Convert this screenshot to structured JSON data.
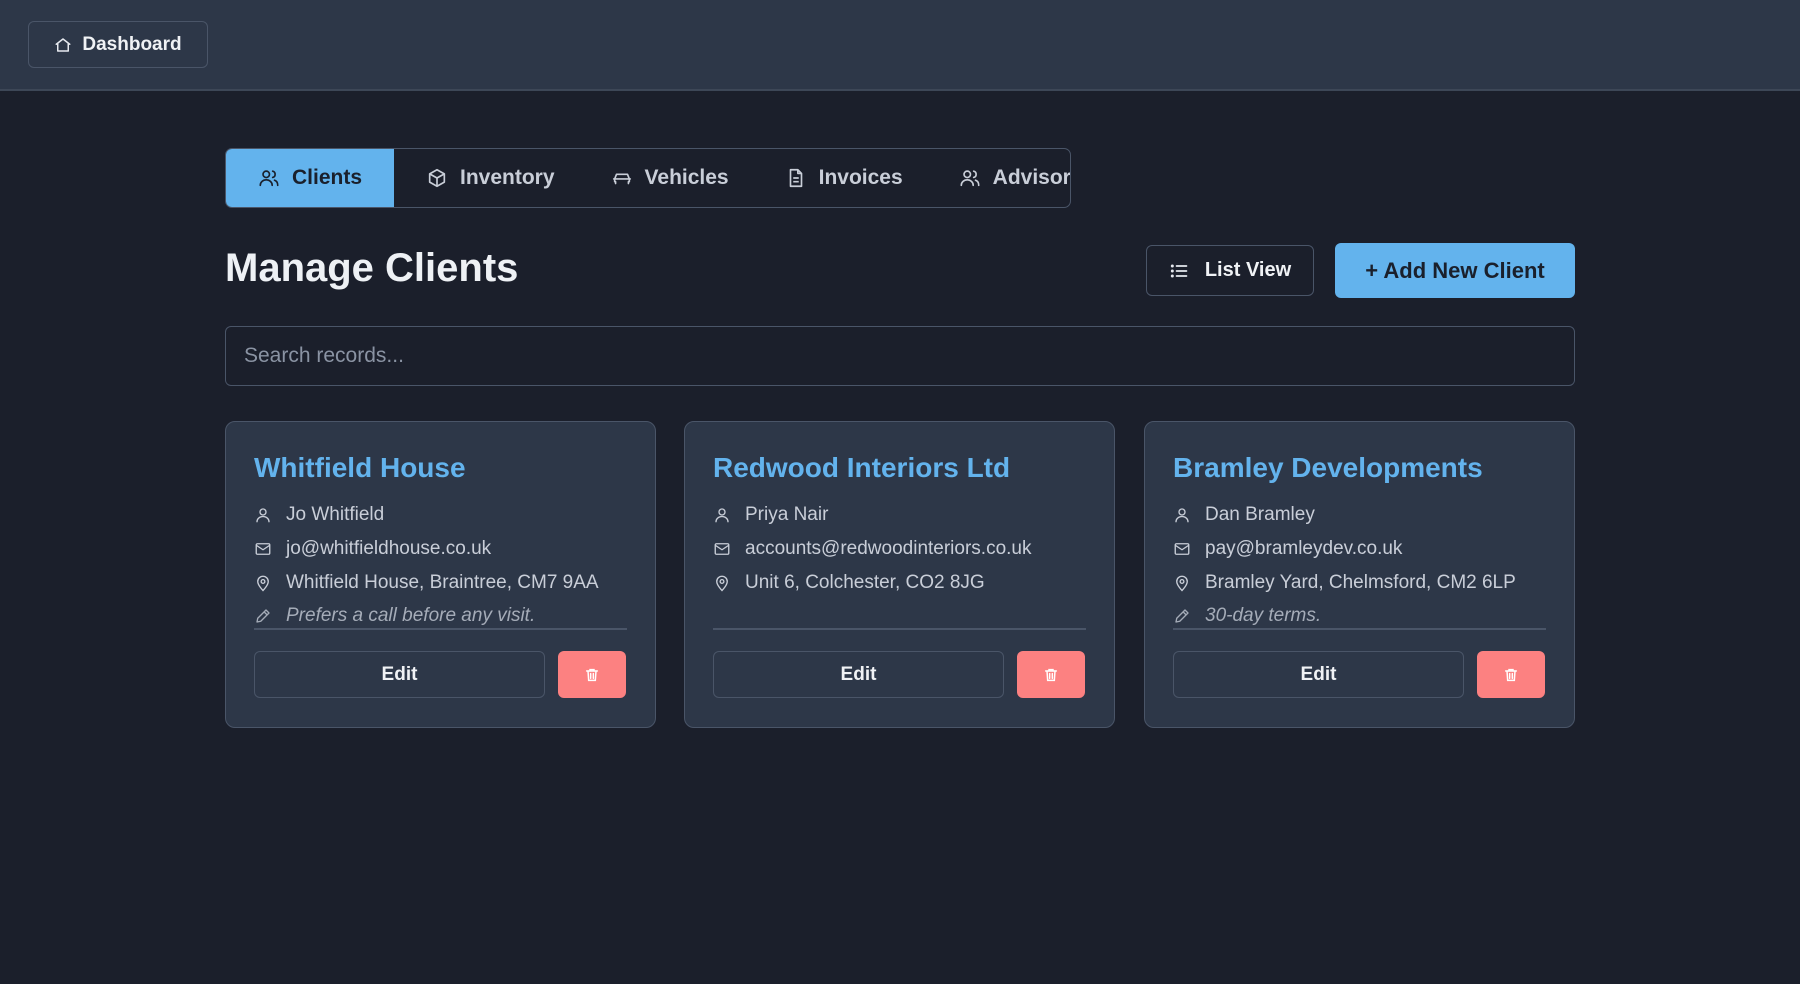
{
  "topbar": {
    "dashboard_label": "Dashboard",
    "dashboard_icon": "home-icon"
  },
  "tabs": [
    {
      "label": "Clients",
      "icon": "users-icon",
      "active": true
    },
    {
      "label": "Inventory",
      "icon": "box-icon",
      "active": false
    },
    {
      "label": "Vehicles",
      "icon": "car-icon",
      "active": false
    },
    {
      "label": "Invoices",
      "icon": "document-icon",
      "active": false
    },
    {
      "label": "Advisors",
      "icon": "users-icon",
      "active": false
    }
  ],
  "header": {
    "title": "Manage Clients",
    "list_view_label": "List View",
    "add_label": "+ Add New Client"
  },
  "search": {
    "placeholder": "Search records...",
    "value": ""
  },
  "clients": [
    {
      "name": "Whitfield House",
      "contact": "Jo Whitfield",
      "email": "jo@whitfieldhouse.co.uk",
      "address": "Whitfield House, Braintree, CM7 9AA",
      "note": "Prefers a call before any visit."
    },
    {
      "name": "Redwood Interiors Ltd",
      "contact": "Priya Nair",
      "email": "accounts@redwoodinteriors.co.uk",
      "address": "Unit 6, Colchester, CO2 8JG",
      "note": ""
    },
    {
      "name": "Bramley Developments",
      "contact": "Dan Bramley",
      "email": "pay@bramleydev.co.uk",
      "address": "Bramley Yard, Chelmsford, CM2 6LP",
      "note": "30-day terms."
    }
  ],
  "card_actions": {
    "edit_label": "Edit",
    "delete_icon": "trash-icon"
  },
  "colors": {
    "accent": "#63b3ed",
    "danger": "#fc8181",
    "background": "#1b1f2b",
    "surface": "#2d3748",
    "border": "#4a5568"
  }
}
